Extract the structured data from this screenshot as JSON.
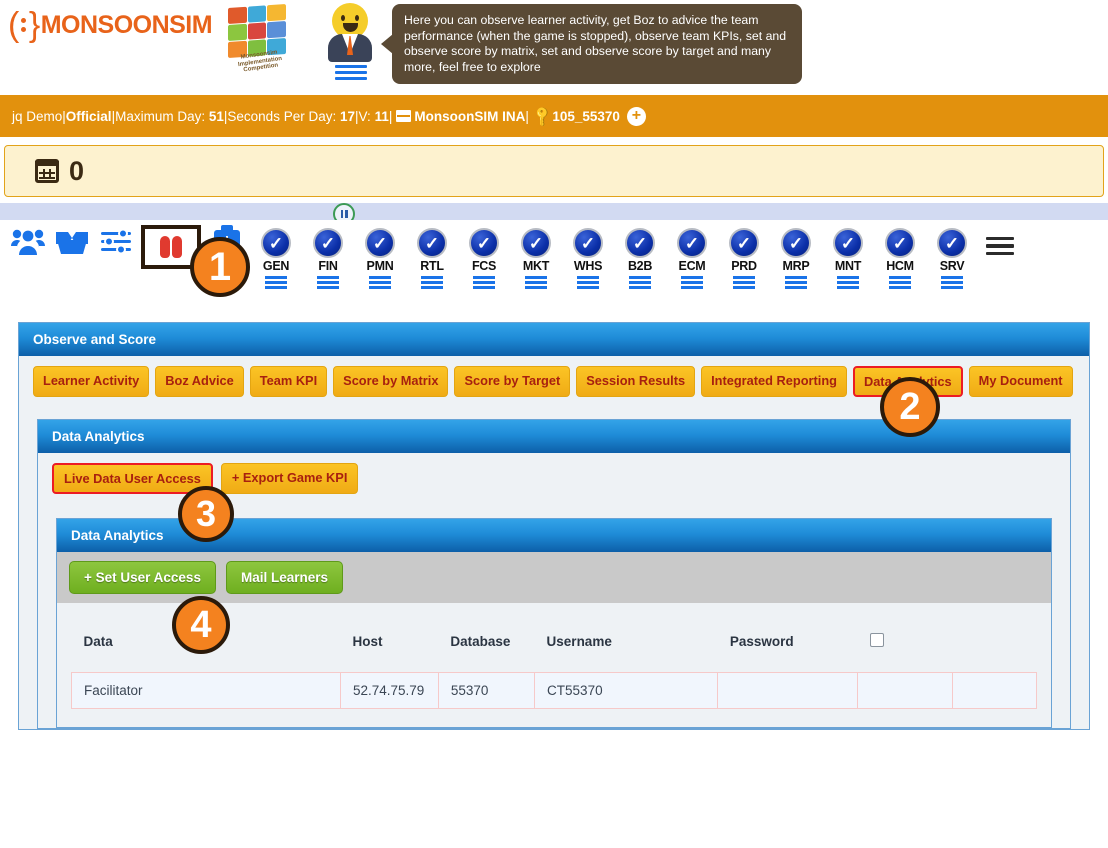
{
  "brand": {
    "name": "MONSOONSIM",
    "cube_caption": "Monsoonsim Implementation Competition",
    "cube_colors": [
      "#e05a2b",
      "#3fa9d8",
      "#f5b731",
      "#8cc63f",
      "#d9463e",
      "#5a8fd8",
      "#f08a2c",
      "#7fbf3f",
      "#3fa9d8"
    ]
  },
  "tooltip": {
    "text": "Here you can observe learner activity, get Boz to advice the team performance (when the game is stopped), observe team KPIs, set and observe score by matrix, set and observe score by target and many more, feel free to explore"
  },
  "session": {
    "name": "jq Demo",
    "sep": " | ",
    "mode": "Official",
    "max_day_label": "Maximum Day:",
    "max_day_value": "51",
    "spd_label": "Seconds Per Day:",
    "spd_value": "17",
    "v_label": "V:",
    "v_value": "11",
    "server": "MonsoonSIM INA",
    "code": "105_55370",
    "plus": "+",
    "bg_color": "#e2910d"
  },
  "day_counter": {
    "value": "0",
    "bg_color": "#fdf2cf",
    "border_color": "#e2a31a"
  },
  "toolbar": {
    "pause_label": "pause",
    "icons": [
      {
        "name": "learners-icon",
        "label": "Learners"
      },
      {
        "name": "package-icon",
        "label": "Inventory"
      },
      {
        "name": "settings-icon",
        "label": "Settings"
      },
      {
        "name": "observe-icon",
        "label": "Observe and Score"
      },
      {
        "name": "toolkit-icon",
        "label": "Toolkit"
      }
    ],
    "modules": [
      {
        "code": "GEN"
      },
      {
        "code": "FIN"
      },
      {
        "code": "PMN"
      },
      {
        "code": "RTL"
      },
      {
        "code": "FCS"
      },
      {
        "code": "MKT"
      },
      {
        "code": "WHS"
      },
      {
        "code": "B2B"
      },
      {
        "code": "ECM"
      },
      {
        "code": "PRD"
      },
      {
        "code": "MRP"
      },
      {
        "code": "MNT"
      },
      {
        "code": "HCM"
      },
      {
        "code": "SRV"
      }
    ],
    "menu_label": "menu"
  },
  "badges": {
    "one": "1",
    "two": "2",
    "three": "3",
    "four": "4",
    "color": "#f4821f"
  },
  "observe_panel": {
    "title": "Observe and Score",
    "tabs": [
      {
        "label": "Learner Activity",
        "selected": false
      },
      {
        "label": "Boz Advice",
        "selected": false
      },
      {
        "label": "Team KPI",
        "selected": false
      },
      {
        "label": "Score by Matrix",
        "selected": false
      },
      {
        "label": "Score by Target",
        "selected": false
      },
      {
        "label": "Session Results",
        "selected": false
      },
      {
        "label": "Integrated Reporting",
        "selected": false
      },
      {
        "label": "Data Analytics",
        "selected": true
      },
      {
        "label": "My Document",
        "selected": false
      }
    ]
  },
  "analytics_panel": {
    "title": "Data Analytics",
    "buttons": [
      {
        "label": "Live Data User Access",
        "selected": true
      },
      {
        "label": "+ Export Game KPI",
        "selected": false
      }
    ]
  },
  "analytics_inner": {
    "title": "Data Analytics",
    "actions": [
      {
        "label": "+ Set User Access"
      },
      {
        "label": "Mail Learners"
      }
    ],
    "table": {
      "headers": [
        "Data",
        "Host",
        "Database",
        "Username",
        "Password",
        ""
      ],
      "rows": [
        {
          "data": "Facilitator",
          "host": "52.74.75.79",
          "database": "55370",
          "username": "CT55370",
          "password": "",
          "extra": ""
        }
      ]
    }
  }
}
